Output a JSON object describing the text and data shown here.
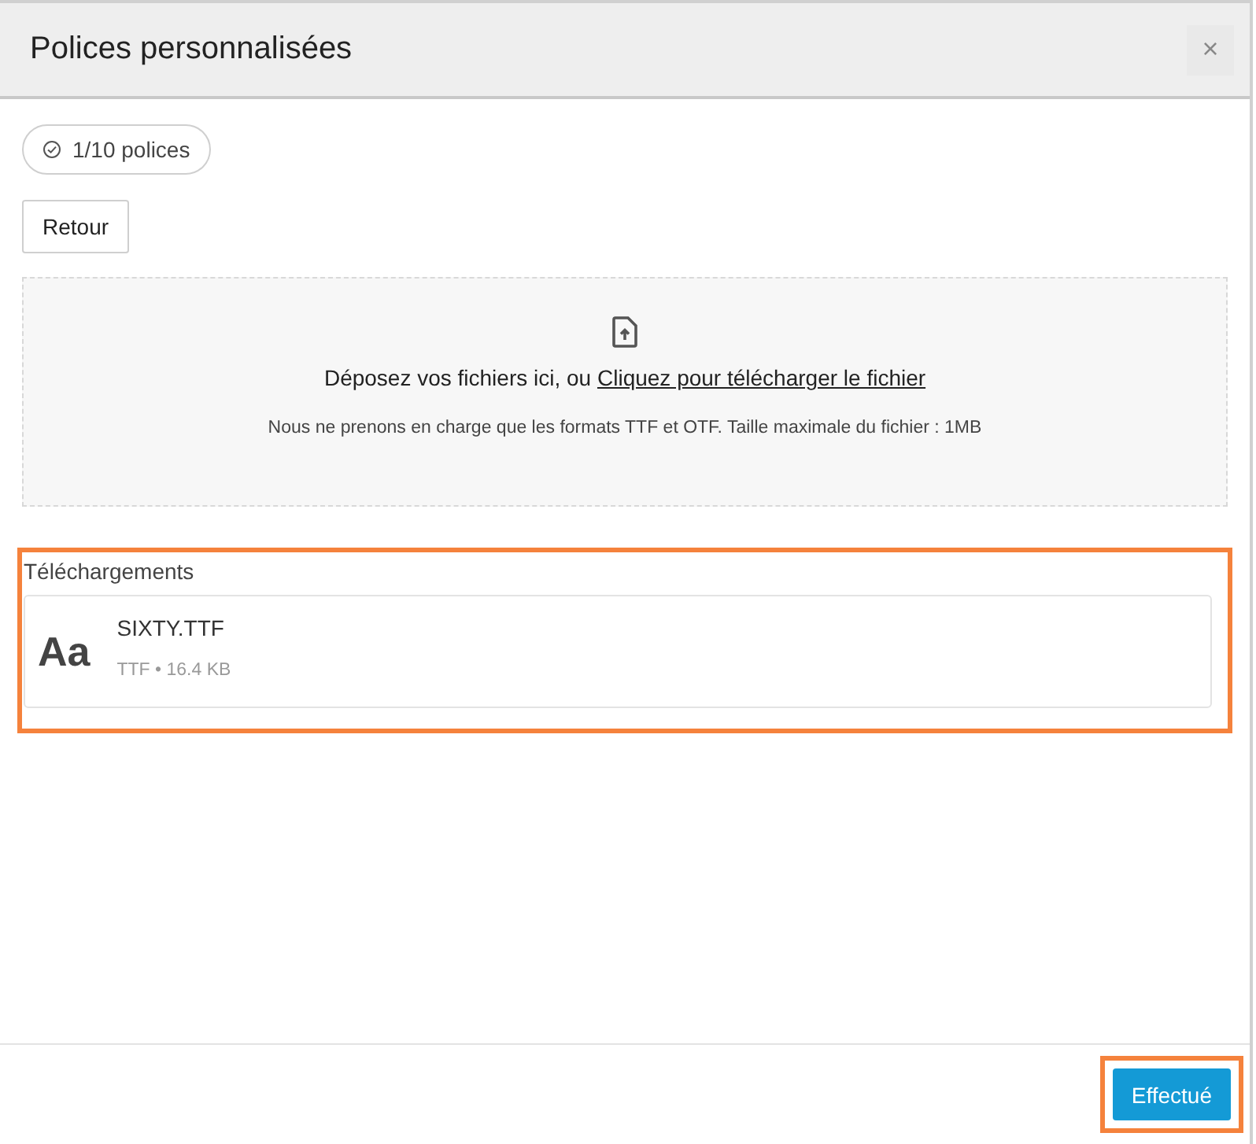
{
  "dialog": {
    "title": "Polices personnalisées",
    "close": "×"
  },
  "quota": {
    "label": "1/10 polices"
  },
  "back_button": "Retour",
  "dropzone": {
    "text": "Déposez vos fichiers ici, ou ",
    "link": "Cliquez pour télécharger le fichier",
    "hint": "Nous ne prenons en charge que les formats TTF et OTF. Taille maximale du fichier : 1MB"
  },
  "uploads": {
    "title": "Téléchargements",
    "highlighted": true,
    "files": [
      {
        "preview": "Aa",
        "name": "SIXTY.TTF",
        "meta": "TTF • 16.4 KB"
      }
    ]
  },
  "footer": {
    "done_button": {
      "label": "Effectué",
      "highlighted": true
    }
  }
}
